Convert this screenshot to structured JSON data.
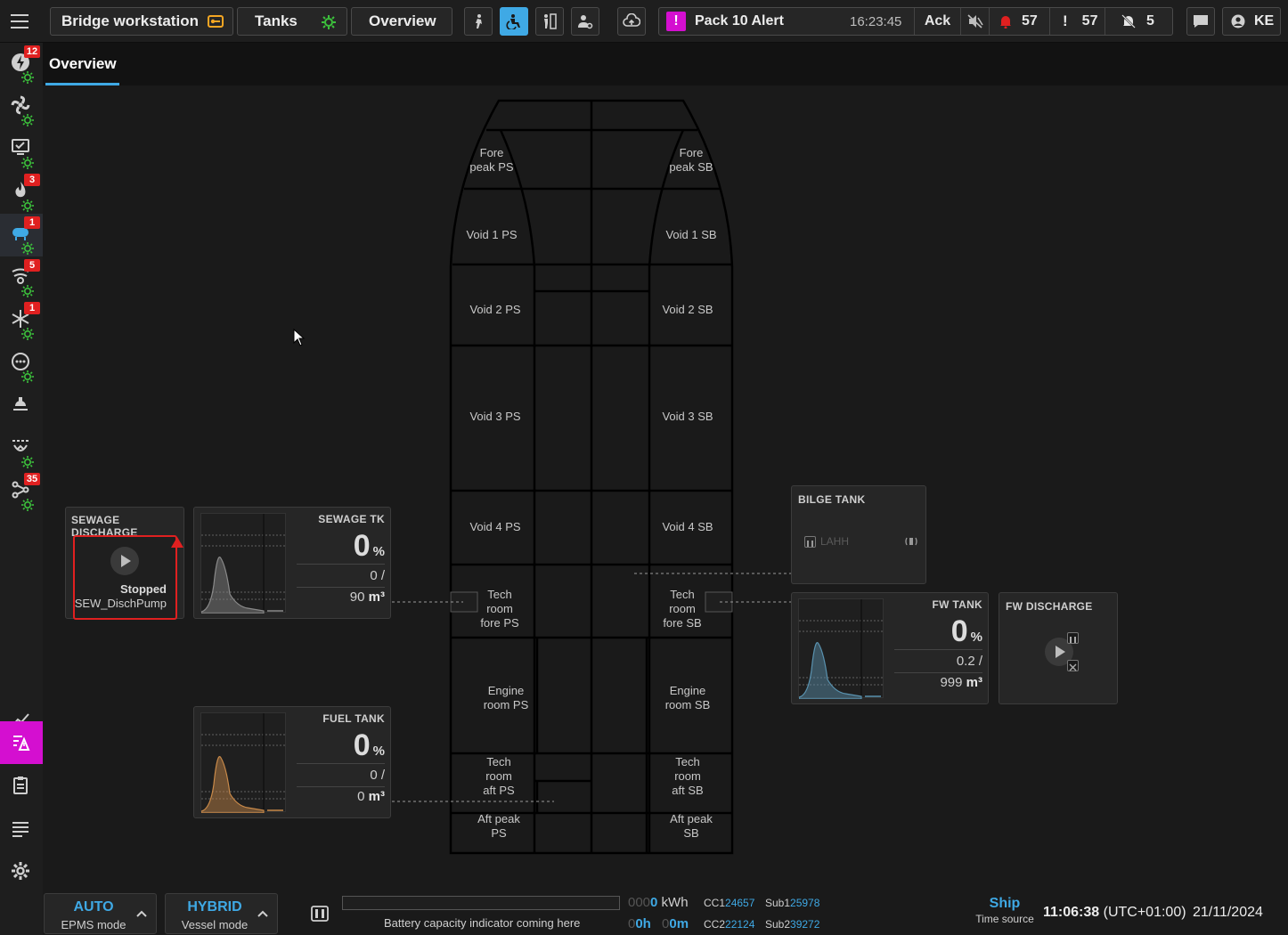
{
  "topbar": {
    "workstation": "Bridge workstation",
    "tanks": "Tanks",
    "overview": "Overview",
    "alert_title": "Pack 10 Alert",
    "alert_time": "16:23:45",
    "ack": "Ack",
    "alarm_count": "57",
    "warning_count": "57",
    "muted_count": "5",
    "user_initials": "KE",
    "colors": {
      "accent": "#3fa9e5",
      "alert": "#d40fd0",
      "ok": "#3cc13c",
      "alarm": "#e02020"
    }
  },
  "rail": {
    "items": [
      {
        "icon": "power-icon",
        "badge": "12"
      },
      {
        "icon": "fan-icon",
        "badge": ""
      },
      {
        "icon": "monitor-icon",
        "badge": ""
      },
      {
        "icon": "flame-icon",
        "badge": "3"
      },
      {
        "icon": "tank-icon",
        "badge": "1"
      },
      {
        "icon": "propulsion-icon",
        "badge": "5"
      },
      {
        "icon": "snowflake-icon",
        "badge": "1"
      },
      {
        "icon": "dots-circle-icon",
        "badge": ""
      },
      {
        "icon": "light-icon",
        "badge": ""
      },
      {
        "icon": "steering-icon",
        "badge": ""
      },
      {
        "icon": "network-icon",
        "badge": "35"
      }
    ]
  },
  "tabs": {
    "overview": "Overview"
  },
  "rooms": {
    "fore_ps": "Fore\npeak PS",
    "fore_sb": "Fore\npeak SB",
    "void1_ps": "Void 1 PS",
    "void1_sb": "Void 1 SB",
    "void2_ps": "Void 2 PS",
    "void2_sb": "Void 2 SB",
    "void3_ps": "Void 3 PS",
    "void3_sb": "Void 3 SB",
    "void4_ps": "Void 4 PS",
    "void4_sb": "Void 4 SB",
    "techfore_ps": "Tech\nroom\nfore PS",
    "techfore_sb": "Tech\nroom\nfore SB",
    "engine_ps": "Engine\nroom PS",
    "engine_sb": "Engine\nroom SB",
    "techaft_ps": "Tech\nroom\naft PS",
    "techaft_sb": "Tech\nroom\naft SB",
    "aft_ps": "Aft peak\nPS",
    "aft_sb": "Aft peak\nSB"
  },
  "sewage_discharge": {
    "title": "SEWAGE DISCHARGE",
    "status": "Stopped",
    "pump": "SEW_DischPump"
  },
  "sewage_tk": {
    "title": "SEWAGE TK",
    "level": "0",
    "pct": "%",
    "volume": "0 /",
    "capacity": "90",
    "unit": "m³",
    "trend_color": "#8a8a8a"
  },
  "fuel_tank": {
    "title": "FUEL TANK",
    "level": "0",
    "pct": "%",
    "volume": "0 /",
    "capacity": "0",
    "unit": "m³",
    "trend_color": "#c98a4a"
  },
  "fw_tank": {
    "title": "FW TANK",
    "level": "0",
    "pct": "%",
    "volume": "0.2 /",
    "capacity": "999",
    "unit": "m³",
    "trend_color": "#5a93b0"
  },
  "bilge_tank": {
    "title": "BILGE TANK",
    "lahh": "LAHH"
  },
  "fw_discharge": {
    "title": "FW DISCHARGE"
  },
  "bottom": {
    "epms_value": "AUTO",
    "epms_label": "EPMS mode",
    "vessel_value": "HYBRID",
    "vessel_label": "Vessel mode",
    "battery_text": "Battery capacity indicator coming here",
    "kwh_dim": "000",
    "kwh_val": "0",
    "kwh_unit": "kWh",
    "h_dim": "0",
    "h_val": "0h",
    "m_dim": "0",
    "m_val": "0m",
    "cc1_label": "CC1",
    "cc1_val": "24657",
    "cc2_label": "CC2",
    "cc2_val": "22124",
    "sub1_label": "Sub1",
    "sub1_val": "25978",
    "sub2_label": "Sub2",
    "sub2_val": "39272",
    "time_source_value": "Ship",
    "time_source_label": "Time source",
    "clock": "11:06:38",
    "tz": "(UTC+01:00)",
    "date": "21/11/2024"
  }
}
